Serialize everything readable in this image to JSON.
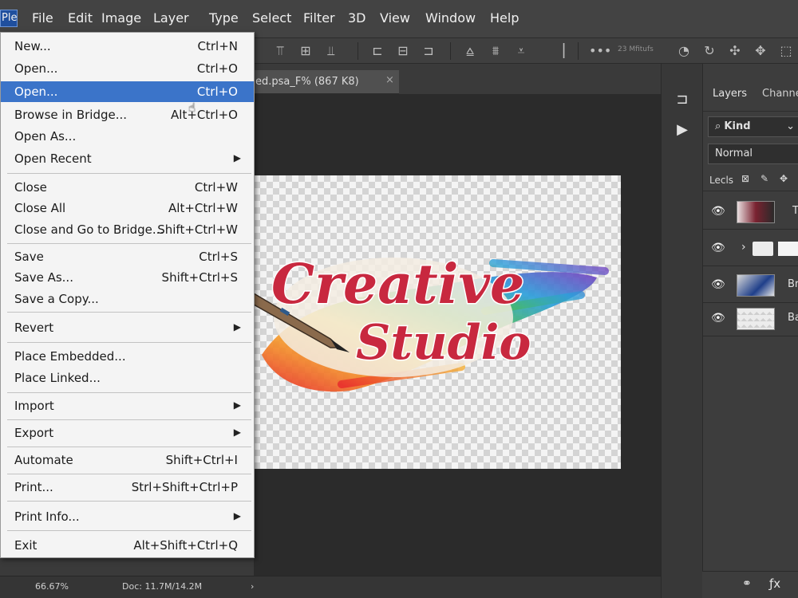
{
  "menubar": {
    "items": [
      {
        "label": "Ple"
      },
      {
        "label": "File"
      },
      {
        "label": "Edit"
      },
      {
        "label": "Image"
      },
      {
        "label": "Layer"
      },
      {
        "label": "Type"
      },
      {
        "label": "Select"
      },
      {
        "label": "Filter"
      },
      {
        "label": "3D"
      },
      {
        "label": "View"
      },
      {
        "label": "Window"
      },
      {
        "label": "Help"
      }
    ],
    "active_index": 0
  },
  "options_bar": {
    "text": "23 Mfitufs"
  },
  "document_tab": {
    "title": "ed.psa_F% (867 K8)",
    "close": "×"
  },
  "artwork": {
    "line1": "Creative",
    "line2": "Studio"
  },
  "file_menu": {
    "items": [
      {
        "label": "New...",
        "shortcut": "Ctrl+N"
      },
      {
        "label": "Open...",
        "shortcut": "Ctrl+O"
      },
      {
        "label": "Open...",
        "shortcut": "Ctrl+O",
        "highlighted": true
      },
      {
        "label": "Browse in Bridge...",
        "shortcut": "Alt+Ctrl+O"
      },
      {
        "label": "Open As...",
        "shortcut": ""
      },
      {
        "label": "Open Recent",
        "shortcut": "",
        "submenu": true
      },
      {
        "label": "Close",
        "shortcut": "Ctrl+W"
      },
      {
        "label": "Close All",
        "shortcut": "Alt+Ctrl+W"
      },
      {
        "label": "Close and Go to Bridge...",
        "shortcut": "Shift+Ctrl+W"
      },
      {
        "label": "Save",
        "shortcut": "Ctrl+S"
      },
      {
        "label": "Save As...",
        "shortcut": "Shift+Ctrl+S"
      },
      {
        "label": "Save a Copy...",
        "shortcut": ""
      },
      {
        "label": "Revert",
        "shortcut": "",
        "submenu": true
      },
      {
        "label": "Place Embedded...",
        "shortcut": ""
      },
      {
        "label": "Place Linked...",
        "shortcut": ""
      },
      {
        "label": "Import",
        "shortcut": "",
        "submenu": true
      },
      {
        "label": "Export",
        "shortcut": "",
        "submenu": true
      },
      {
        "label": "Automate",
        "shortcut": "Shift+Ctrl+I"
      },
      {
        "label": "Print...",
        "shortcut": "Strl+Shift+Ctrl+P"
      },
      {
        "label": "Print Info...",
        "shortcut": "",
        "submenu": true
      },
      {
        "label": "Exit",
        "shortcut": "Alt+Shift+Ctrl+Q"
      }
    ],
    "submenu_glyph": "▶"
  },
  "layers_panel": {
    "tabs": [
      "Layers",
      "Channe"
    ],
    "filter_label": "Kind",
    "blend_mode": "Normal",
    "lock_label": "Lecls",
    "layers": [
      {
        "name": "T",
        "visible": true
      },
      {
        "name": "",
        "visible": true,
        "group": true
      },
      {
        "name": "Bru",
        "visible": true
      },
      {
        "name": "Ba",
        "visible": true
      }
    ]
  },
  "status_bar": {
    "zoom": "66.67%",
    "doc": "Doc: 11.7M/14.2M",
    "arrow": "›"
  },
  "colors": {
    "highlight": "#3b74c9",
    "title_red": "#c8283f",
    "menu_bg": "#f4f4f4"
  }
}
